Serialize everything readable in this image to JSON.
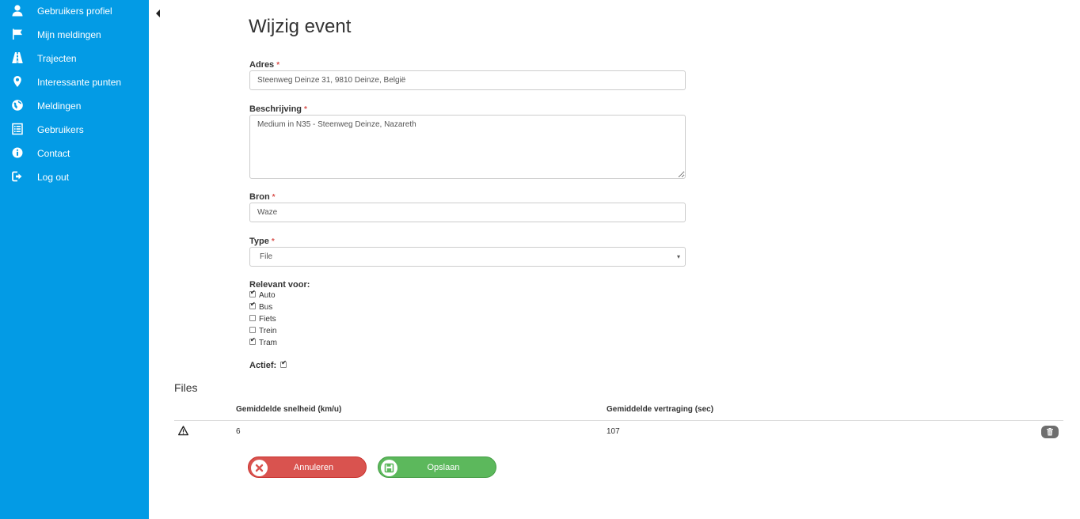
{
  "sidebar": {
    "items": [
      {
        "label": "Gebruikers profiel",
        "icon": "user-icon"
      },
      {
        "label": "Mijn meldingen",
        "icon": "flag-icon"
      },
      {
        "label": "Trajecten",
        "icon": "road-icon"
      },
      {
        "label": "Interessante punten",
        "icon": "map-marker-icon"
      },
      {
        "label": "Meldingen",
        "icon": "globe-icon"
      },
      {
        "label": "Gebruikers",
        "icon": "list-icon"
      },
      {
        "label": "Contact",
        "icon": "info-icon"
      },
      {
        "label": "Log out",
        "icon": "log-out-icon"
      }
    ],
    "background_color": "#039be5"
  },
  "form": {
    "title": "Wijzig event",
    "address": {
      "label": "Adres",
      "value": "Steenweg Deinze 31, 9810 Deinze, België",
      "required_mark": "*"
    },
    "description": {
      "label": "Beschrijving",
      "value": "Medium in N35 - Steenweg Deinze, Nazareth",
      "required_mark": "*"
    },
    "source": {
      "label": "Bron",
      "value": "Waze",
      "required_mark": "*"
    },
    "type": {
      "label": "Type",
      "value": "File",
      "required_mark": "*",
      "caret": "▾"
    },
    "relevant": {
      "label": "Relevant voor:",
      "options": [
        {
          "label": "Auto",
          "checked": true
        },
        {
          "label": "Bus",
          "checked": true
        },
        {
          "label": "Fiets",
          "checked": false
        },
        {
          "label": "Trein",
          "checked": false
        },
        {
          "label": "Tram",
          "checked": true
        }
      ]
    },
    "active": {
      "label": "Actief:",
      "checked": true
    }
  },
  "files": {
    "title": "Files",
    "columns": [
      "Gemiddelde snelheid (km/u)",
      "Gemiddelde vertraging (sec)"
    ],
    "rows": [
      {
        "icon": "warning-icon",
        "speed": "6",
        "delay": "107"
      }
    ]
  },
  "buttons": {
    "cancel": {
      "label": "Annuleren",
      "color": "#d9534f",
      "icon": "close-icon"
    },
    "save": {
      "label": "Opslaan",
      "color": "#5cb85c",
      "icon": "save-icon"
    }
  }
}
